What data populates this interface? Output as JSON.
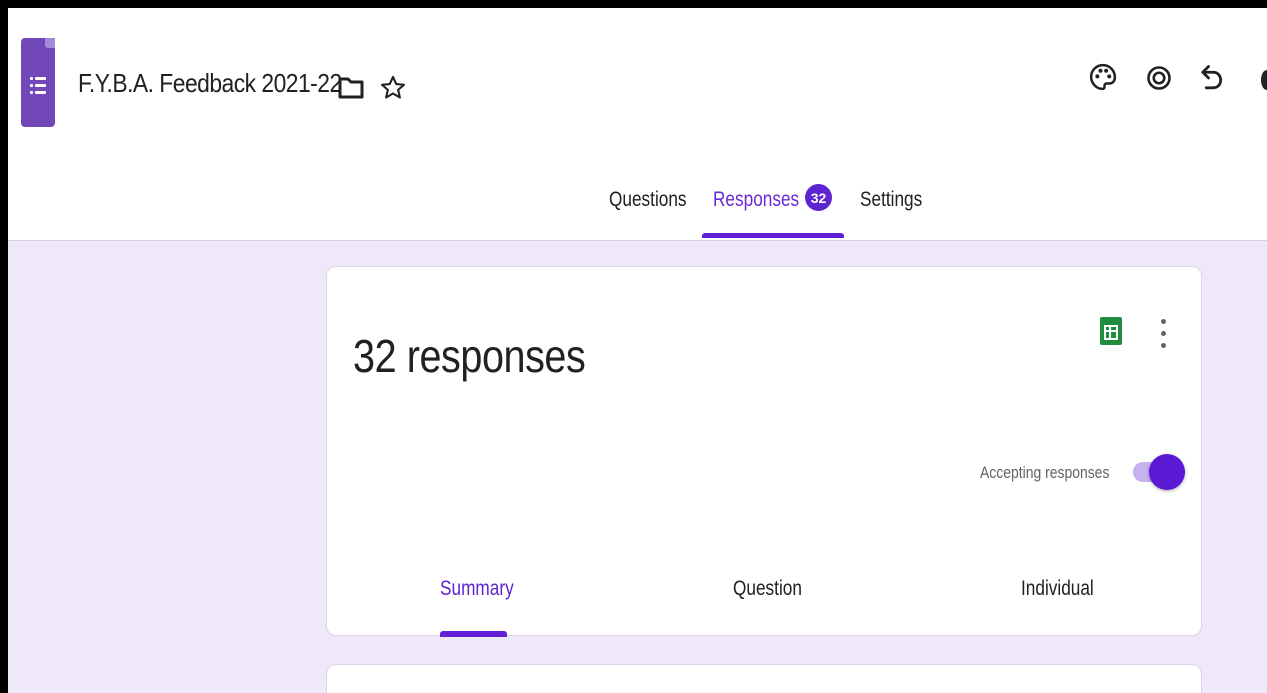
{
  "header": {
    "title": "F.Y.B.A. Feedback 2021-22",
    "icons": {
      "app": "google-forms-icon",
      "folder": "folder-icon",
      "star": "star-icon",
      "palette": "palette-icon",
      "preview": "eye-icon",
      "undo": "undo-icon"
    }
  },
  "tabs": [
    {
      "label": "Questions"
    },
    {
      "label": "Responses",
      "badge": "32",
      "active": true
    },
    {
      "label": "Settings"
    }
  ],
  "summary_card": {
    "count_label": "32 responses",
    "accepting_label": "Accepting responses",
    "accepting": true,
    "sheets_icon": "google-sheets-icon",
    "more_icon": "more-vert-icon",
    "subtabs": [
      {
        "label": "Summary",
        "active": true
      },
      {
        "label": "Question"
      },
      {
        "label": "Individual"
      }
    ]
  },
  "colors": {
    "accent": "#6120d6",
    "background": "#efe8f8",
    "sheets_green": "#1e8e3e"
  }
}
